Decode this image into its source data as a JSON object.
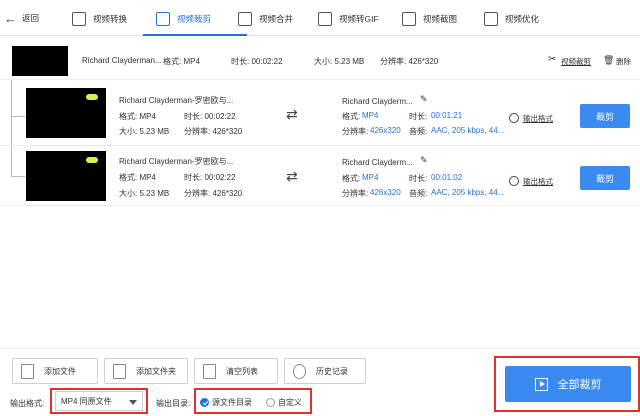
{
  "nav": {
    "back_label": "返回",
    "tabs": [
      {
        "label": "视频转换",
        "active": false,
        "icon": "convert-icon"
      },
      {
        "label": "视频裁剪",
        "active": true,
        "icon": "crop-icon"
      },
      {
        "label": "视频合并",
        "active": false,
        "icon": "merge-icon"
      },
      {
        "label": "视频转GIF",
        "active": false,
        "icon": "gif-icon"
      },
      {
        "label": "视频截图",
        "active": false,
        "icon": "screenshot-icon"
      },
      {
        "label": "视频优化",
        "active": false,
        "icon": "optimize-icon"
      }
    ]
  },
  "source_file": {
    "name": "Richard Clayderman...",
    "format": "格式: MP4",
    "duration": "时长: 00:02:22",
    "size": "大小: 5.23 MB",
    "resolution": "分辨率: 426*320",
    "crop_link": "视频裁剪",
    "delete_link": "删除"
  },
  "clips": [
    {
      "name": "Richard Clayderman-罗密欧与...",
      "format": "格式: MP4",
      "duration": "时长: 00:02:22",
      "size": "大小: 5.23 MB",
      "resolution": "分辨率: 426*320",
      "out_name": "Richard Clayderm...",
      "out_format_label": "格式:",
      "out_format_value": "MP4",
      "out_duration_label": "时长:",
      "out_duration_value": "00:01:21",
      "out_res_label": "分辨率:",
      "out_res_value": "426x320",
      "out_audio_label": "音频:",
      "out_audio_value": "AAC, 205 kbps, 44...",
      "format_link": "输出格式",
      "crop_button": "裁剪"
    },
    {
      "name": "Richard Clayderman-罗密欧与...",
      "format": "格式: MP4",
      "duration": "时长: 00:02:22",
      "size": "大小: 5.23 MB",
      "resolution": "分辨率: 426*320",
      "out_name": "Richard Clayderm...",
      "out_format_label": "格式:",
      "out_format_value": "MP4",
      "out_duration_label": "时长:",
      "out_duration_value": "00:01:02",
      "out_res_label": "分辨率:",
      "out_res_value": "426x320",
      "out_audio_label": "音频:",
      "out_audio_value": "AAC, 205 kbps, 44...",
      "format_link": "输出格式",
      "crop_button": "裁剪"
    }
  ],
  "toolbar": {
    "add_file": "添加文件",
    "add_folder": "添加文件夹",
    "clear_list": "清空列表",
    "history": "历史记录"
  },
  "output": {
    "format_label": "输出格式:",
    "format_value": "MP4 同原文件",
    "dir_label": "输出目录:",
    "dir_options": [
      {
        "label": "源文件目录",
        "checked": true
      },
      {
        "label": "自定义",
        "checked": false
      }
    ]
  },
  "main_action": "全部裁剪",
  "colors": {
    "accent": "#3b8af0",
    "highlight": "#e23030"
  }
}
